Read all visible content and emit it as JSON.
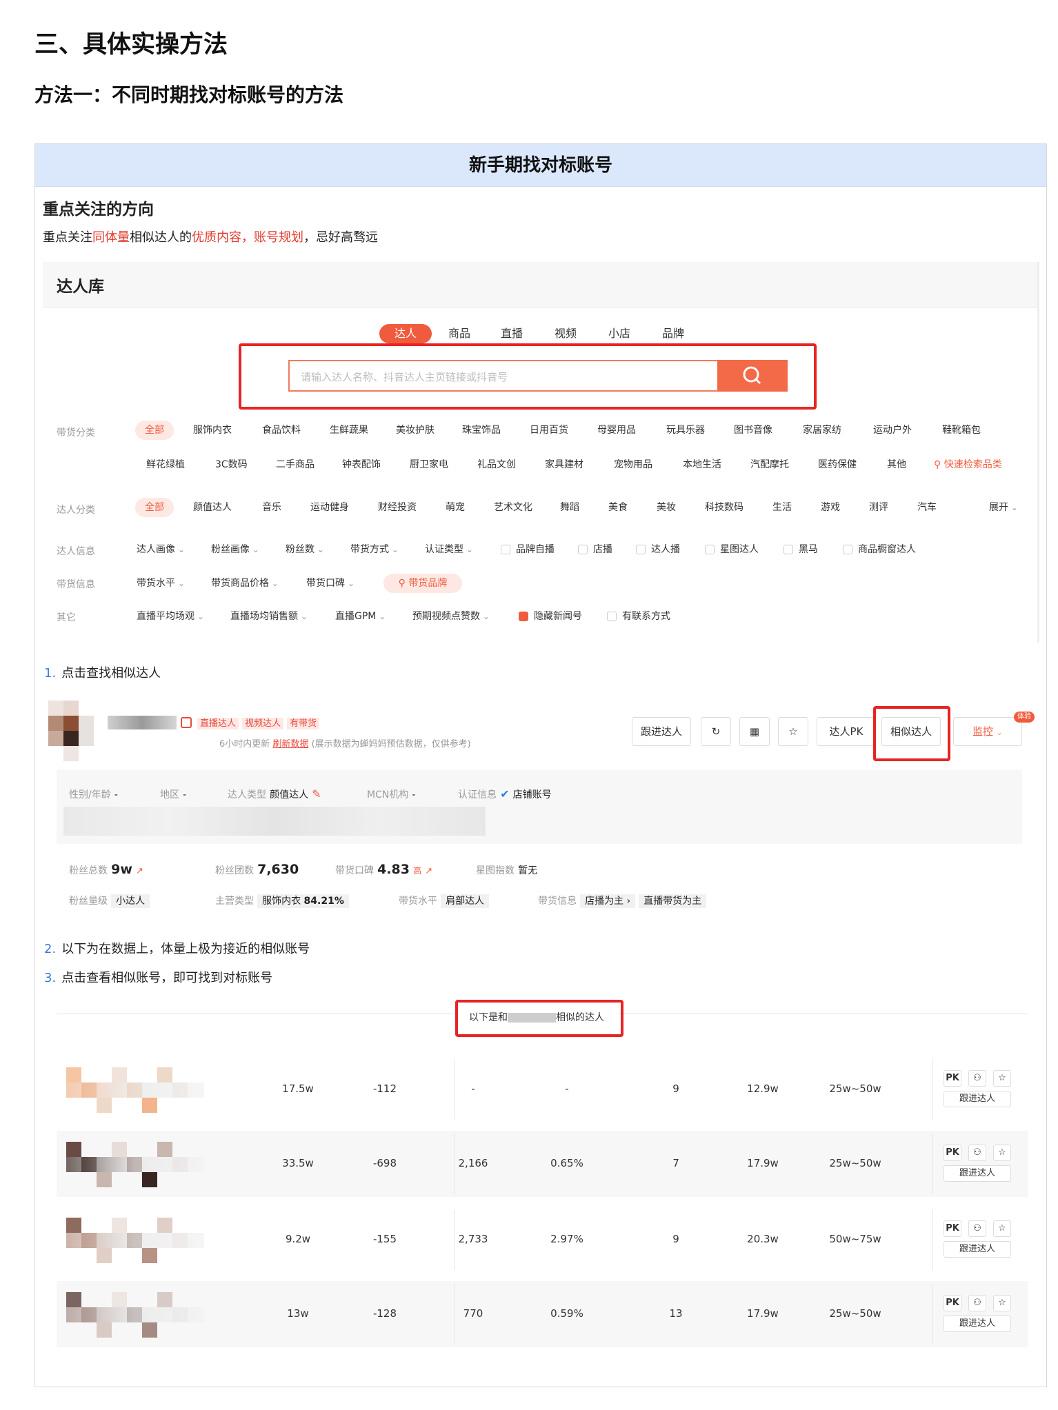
{
  "heading": "三、具体实操方法",
  "subheading": "方法一：不同时期找对标账号的方法",
  "card_title": "新手期找对标账号",
  "focus": {
    "title": "重点关注的方向",
    "p1": "重点关注",
    "p2": "同体量",
    "p3": "相似达人的",
    "p4": "优质内容，账号规划",
    "p5": "，忌好高骛远"
  },
  "library": {
    "title": "达人库",
    "tabs": [
      "达人",
      "商品",
      "直播",
      "视频",
      "小店",
      "品牌"
    ],
    "search_placeholder": "请输入达人名称、抖音达人主页链接或抖音号",
    "goods_label": "带货分类",
    "goods_row1": [
      "全部",
      "服饰内衣",
      "食品饮料",
      "生鲜蔬果",
      "美妆护肤",
      "珠宝饰品",
      "日用百货",
      "母婴用品",
      "玩具乐器",
      "图书音像",
      "家居家纺",
      "运动户外",
      "鞋靴箱包"
    ],
    "goods_row2": [
      "鲜花绿植",
      "3C数码",
      "二手商品",
      "钟表配饰",
      "厨卫家电",
      "礼品文创",
      "家具建材",
      "宠物用品",
      "本地生活",
      "汽配摩托",
      "医药保健",
      "其他"
    ],
    "goods_quick": "快速检索品类",
    "talent_label": "达人分类",
    "talent_row": [
      "全部",
      "颜值达人",
      "音乐",
      "运动健身",
      "财经投资",
      "萌宠",
      "艺术文化",
      "舞蹈",
      "美食",
      "美妆",
      "科技数码",
      "生活",
      "游戏",
      "测评",
      "汽车"
    ],
    "expand": "展开",
    "info_label": "达人信息",
    "info_dds": [
      "达人画像",
      "粉丝画像",
      "粉丝数",
      "带货方式",
      "认证类型"
    ],
    "info_cbs": [
      "品牌自播",
      "店播",
      "达人播",
      "星图达人",
      "黑马",
      "商品橱窗达人"
    ],
    "sales_label": "带货信息",
    "sales_dds": [
      "带货水平",
      "带货商品价格",
      "带货口碑"
    ],
    "sales_brand": "带货品牌",
    "other_label": "其它",
    "other_dds": [
      "直播平均场观",
      "直播场均销售额",
      "直播GPM",
      "预期视频点赞数"
    ],
    "other_cbs": [
      "隐藏新闻号",
      "有联系方式"
    ]
  },
  "steps": {
    "s1_num": "1.",
    "s1": "点击查找相似达人",
    "s2_num": "2.",
    "s2": "以下为在数据上，体量上极为接近的相似账号",
    "s3_num": "3.",
    "s3": "点击查看相似账号，即可找到对标账号"
  },
  "profile": {
    "tags": [
      "直播达人",
      "视频达人",
      "有带货"
    ],
    "update": "6小时内更新",
    "refresh": "刷新数据",
    "note": "(展示数据为蝉妈妈预估数据，仅供参考)",
    "buttons": [
      "跟进达人",
      "达人PK",
      "相似达人",
      "监控"
    ],
    "badge": "体验",
    "gender_label": "性别/年龄",
    "gender_val": "-",
    "area_label": "地区",
    "area_val": "-",
    "type_label": "达人类型",
    "type_val": "颜值达人",
    "mcn_label": "MCN机构",
    "mcn_val": "-",
    "auth_label": "认证信息",
    "auth_val": "店铺账号",
    "fans_label": "粉丝总数",
    "fans_val": "9w",
    "group_label": "粉丝团数",
    "group_val": "7,630",
    "rep_label": "带货口碑",
    "rep_val": "4.83",
    "rep_tag": "高",
    "star_label": "星图指数",
    "star_val": "暂无",
    "level_label": "粉丝量级",
    "level_val": "小达人",
    "cat_label": "主营类型",
    "cat_val": "服饰内衣",
    "cat_pct": "84.21%",
    "sales_label": "带货水平",
    "sales_val": "肩部达人",
    "binfo_label": "带货信息",
    "binfo_val1": "店播为主 ›",
    "binfo_val2": "直播带货为主"
  },
  "similar": {
    "title_a": "以下是和",
    "title_b": "相似的达人",
    "rows": [
      {
        "fans": "17.5w",
        "delta": "-112",
        "c3": "-",
        "c4": "-",
        "c5": "9",
        "c6": "12.9w",
        "c7": "25w~50w"
      },
      {
        "fans": "33.5w",
        "delta": "-698",
        "c3": "2,166",
        "c4": "0.65%",
        "c5": "7",
        "c6": "17.9w",
        "c7": "25w~50w"
      },
      {
        "fans": "9.2w",
        "delta": "-155",
        "c3": "2,733",
        "c4": "2.97%",
        "c5": "9",
        "c6": "20.3w",
        "c7": "50w~75w"
      },
      {
        "fans": "13w",
        "delta": "-128",
        "c3": "770",
        "c4": "0.59%",
        "c5": "13",
        "c6": "17.9w",
        "c7": "25w~50w"
      }
    ],
    "pk": "PK",
    "follow": "跟进达人"
  },
  "colors": {
    "accent": "#f05b3e",
    "highlight_box": "#e62424",
    "header_bg": "#dbe8fb",
    "step_num": "#3a78d6"
  }
}
